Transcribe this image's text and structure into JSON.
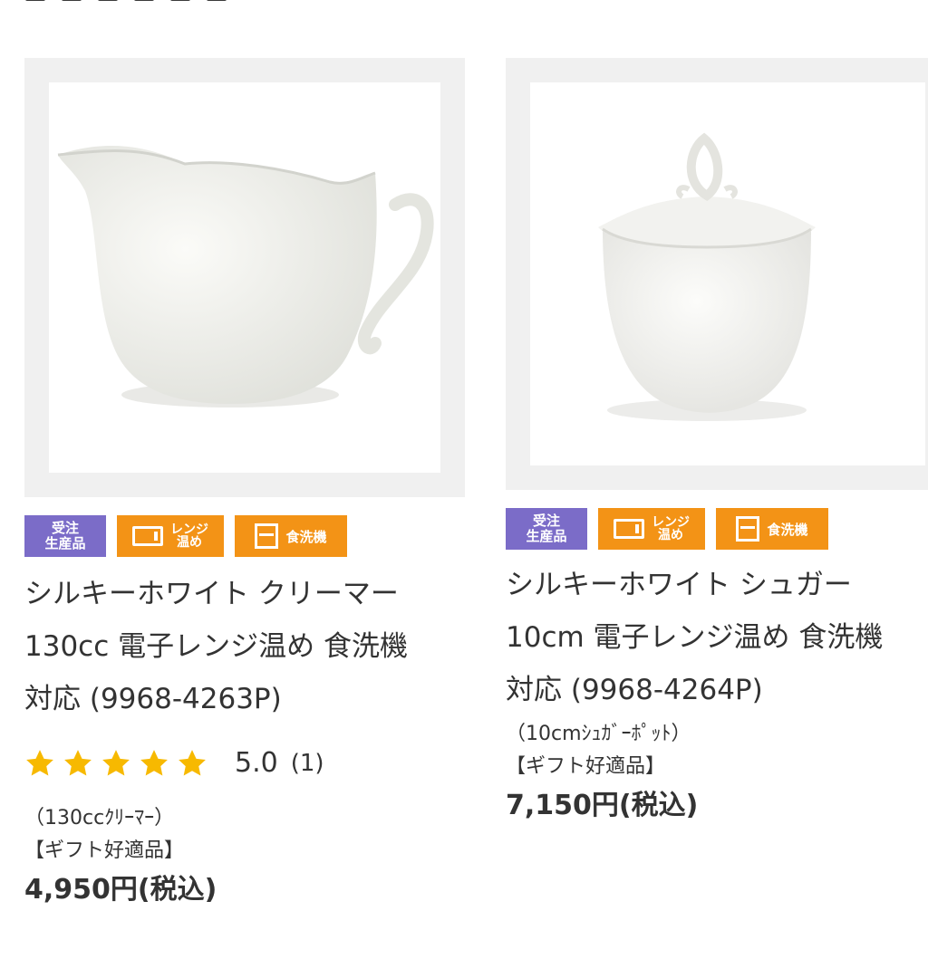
{
  "products": [
    {
      "name_line1": "シルキーホワイト クリーマー",
      "name_line2": "130cc 電子レンジ温め 食洗機",
      "name_line3": "対応 (9968-4263P)",
      "badges": {
        "order": [
          "受注",
          "生産品"
        ],
        "range": [
          "レンジ",
          "温め"
        ],
        "dish": "食洗機"
      },
      "rating": {
        "stars": 5,
        "value": "5.0",
        "count": "(1)"
      },
      "sub1": "（130ccｸﾘｰﾏｰ）",
      "sub2": "【ギフト好適品】",
      "price": "4,950円(税込)"
    },
    {
      "name_line1": "シルキーホワイト シュガー",
      "name_line2": "10cm 電子レンジ温め 食洗機",
      "name_line3": "対応 (9968-4264P)",
      "badges": {
        "order": [
          "受注",
          "生産品"
        ],
        "range": [
          "レンジ",
          "温め"
        ],
        "dish": "食洗機"
      },
      "sub1": "（10cmｼｭｶﾞｰﾎﾟｯﾄ）",
      "sub2": "【ギフト好適品】",
      "price": "7,150円(税込)"
    }
  ],
  "colors": {
    "badge_order": "#7b6cc8",
    "badge_feature": "#f39316",
    "star": "#f7b900"
  }
}
